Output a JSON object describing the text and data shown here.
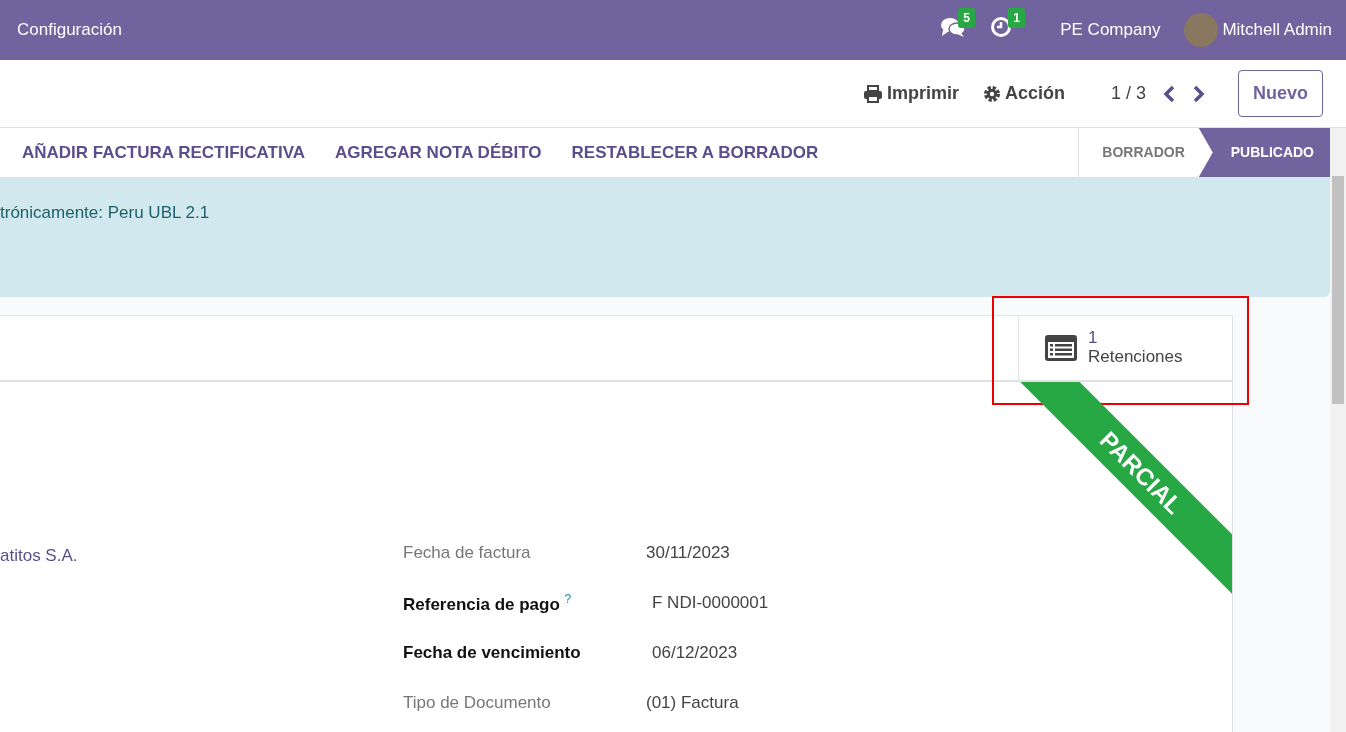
{
  "navbar": {
    "menu": "Configuración",
    "messages_count": "5",
    "activities_count": "1",
    "company": "PE Company",
    "user": "Mitchell Admin"
  },
  "control_panel": {
    "print": "Imprimir",
    "action": "Acción",
    "pager": "1 / 3",
    "new_button": "Nuevo"
  },
  "status_bar": {
    "buttons": [
      "AÑADIR FACTURA RECTIFICATIVA",
      "AGREGAR NOTA DÉBITO",
      "RESTABLECER A BORRADOR"
    ],
    "stages": [
      {
        "label": "BORRADOR",
        "selected": false
      },
      {
        "label": "PUBLICADO",
        "selected": true
      }
    ]
  },
  "alert": {
    "text": "trónicamente: Peru UBL 2.1"
  },
  "sheet": {
    "smart_buttons": [
      {
        "value": "1",
        "label": "Retenciones",
        "highlighted": true
      }
    ],
    "ribbon": "PARCIAL",
    "partner": "atitos S.A.",
    "fields": [
      {
        "label": "Fecha de factura",
        "value": "30/11/2023",
        "required": false
      },
      {
        "label": "Referencia de pago",
        "value": "F NDI-0000001",
        "required": true,
        "help_mark": "?"
      },
      {
        "label": "Fecha de vencimiento",
        "value": "06/12/2023",
        "required": true
      },
      {
        "label": "Tipo de Documento",
        "value": "(01) Factura",
        "required": false
      }
    ]
  }
}
